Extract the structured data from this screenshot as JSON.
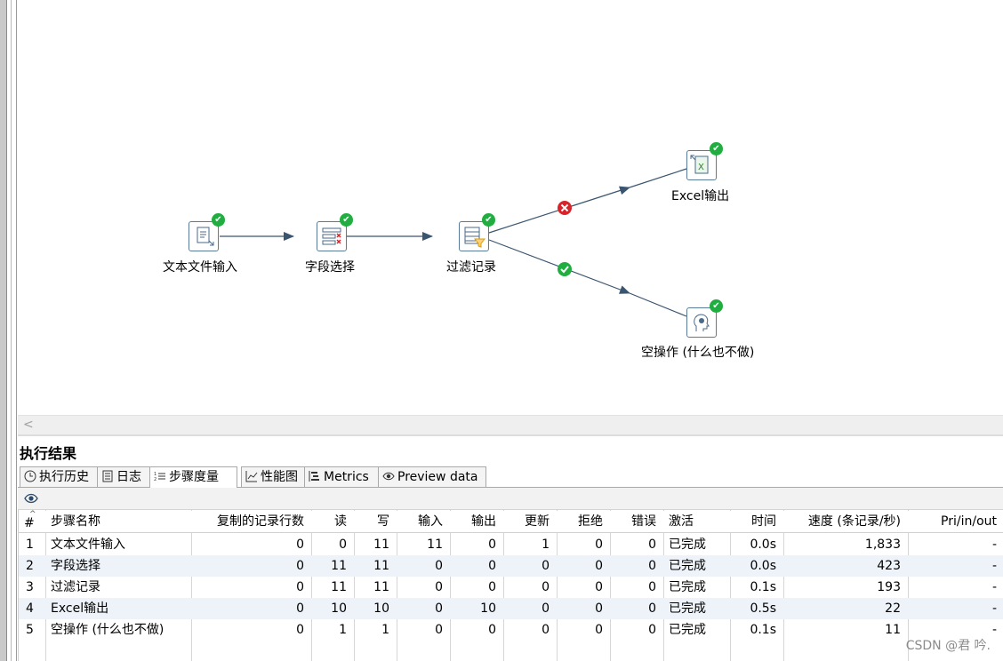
{
  "canvas": {
    "steps": [
      {
        "name": "文本文件输入"
      },
      {
        "name": "字段选择"
      },
      {
        "name": "过滤记录"
      },
      {
        "name": "Excel输出"
      },
      {
        "name": "空操作 (什么也不做)"
      }
    ]
  },
  "panel": {
    "title": "执行结果",
    "tabs": [
      {
        "label": "执行历史",
        "icon": "clock-icon"
      },
      {
        "label": "日志",
        "icon": "log-icon"
      },
      {
        "label": "步骤度量",
        "icon": "step-metrics-icon"
      },
      {
        "label": "性能图",
        "icon": "chart-icon"
      },
      {
        "label": "Metrics",
        "icon": "metrics-icon"
      },
      {
        "label": "Preview data",
        "icon": "eye-icon"
      }
    ],
    "active_tab": "步骤度量",
    "toolbar_icon": "eye-icon"
  },
  "table": {
    "headers": [
      "#",
      "步骤名称",
      "复制的记录行数",
      "读",
      "写",
      "输入",
      "输出",
      "更新",
      "拒绝",
      "错误",
      "激活",
      "时间",
      "速度 (条记录/秒)",
      "Pri/in/out"
    ],
    "rows": [
      [
        "1",
        "文本文件输入",
        "0",
        "0",
        "11",
        "11",
        "0",
        "1",
        "0",
        "0",
        "已完成",
        "0.0s",
        "1,833",
        "-"
      ],
      [
        "2",
        "字段选择",
        "0",
        "11",
        "11",
        "0",
        "0",
        "0",
        "0",
        "0",
        "已完成",
        "0.0s",
        "423",
        "-"
      ],
      [
        "3",
        "过滤记录",
        "0",
        "11",
        "11",
        "0",
        "0",
        "0",
        "0",
        "0",
        "已完成",
        "0.1s",
        "193",
        "-"
      ],
      [
        "4",
        "Excel输出",
        "0",
        "10",
        "10",
        "0",
        "10",
        "0",
        "0",
        "0",
        "已完成",
        "0.5s",
        "22",
        "-"
      ],
      [
        "5",
        "空操作 (什么也不做)",
        "0",
        "1",
        "1",
        "0",
        "0",
        "0",
        "0",
        "0",
        "已完成",
        "0.1s",
        "11",
        "-"
      ]
    ]
  },
  "watermark": "CSDN @君    吟.",
  "colors": {
    "ok": "#1fae3f",
    "error": "#d8232a",
    "hop": "#3a5570",
    "row_alt": "#eef3fa"
  }
}
